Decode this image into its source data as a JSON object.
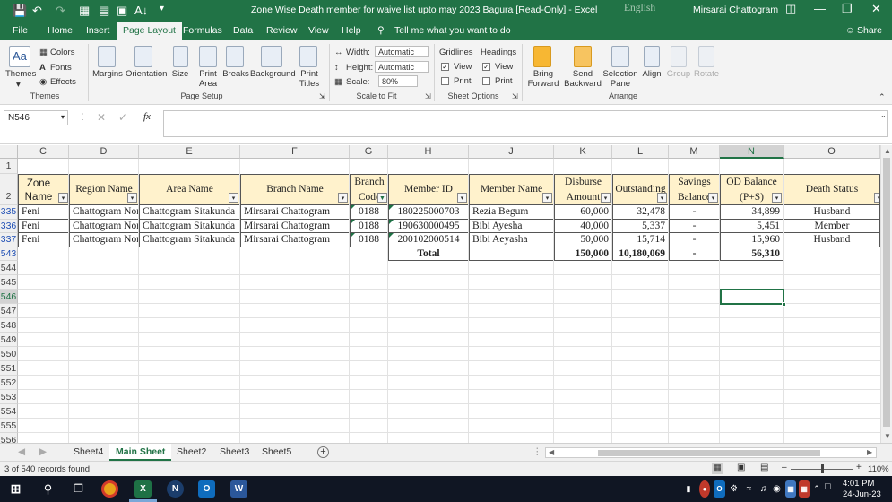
{
  "window": {
    "title": "Zone Wise Death member for waive list upto may 2023 Bagura  [Read-Only]  -  Excel",
    "language": "English",
    "user": "Mirsarai Chattogram"
  },
  "ribbon_tabs": [
    "File",
    "Home",
    "Insert",
    "Page Layout",
    "Formulas",
    "Data",
    "Review",
    "View",
    "Help"
  ],
  "active_tab": "Page Layout",
  "tell_me": "Tell me what you want to do",
  "share": "Share",
  "ribbon": {
    "themes": {
      "themes": "Themes",
      "colors": "Colors",
      "fonts": "Fonts",
      "effects": "Effects",
      "group": "Themes"
    },
    "page_setup": {
      "margins": "Margins",
      "orientation": "Orientation",
      "size": "Size",
      "print_area": "Print Area",
      "breaks": "Breaks",
      "background": "Background",
      "print_titles": "Print Titles",
      "group": "Page Setup"
    },
    "scale": {
      "width_label": "Width:",
      "width_value": "Automatic",
      "height_label": "Height:",
      "height_value": "Automatic",
      "scale_label": "Scale:",
      "scale_value": "80%",
      "group": "Scale to Fit"
    },
    "sheet_options": {
      "gridlines": "Gridlines",
      "headings": "Headings",
      "view": "View",
      "print": "Print",
      "group": "Sheet Options"
    },
    "arrange": {
      "bring_forward": "Bring Forward",
      "send_backward": "Send Backward",
      "selection_pane": "Selection Pane",
      "align": "Align",
      "group_btn": "Group",
      "rotate": "Rotate",
      "group": "Arrange"
    }
  },
  "formula_bar": {
    "name_box": "N546",
    "fx": "fx",
    "content": ""
  },
  "columns": [
    "C",
    "D",
    "E",
    "F",
    "G",
    "H",
    "J",
    "K",
    "L",
    "M",
    "N",
    "O"
  ],
  "header_row": {
    "zone": "Zone Name",
    "region": "Region Name",
    "area": "Area Name",
    "branch": "Branch Name",
    "branch_code": "Branch Code",
    "member_id": "Member ID",
    "member_name": "Member Name",
    "disburse": "Disburse Amount",
    "outstanding": "Outstanding",
    "savings": "Savings Balance",
    "od": "OD Balance (P+S)",
    "death": "Death Status"
  },
  "rows": [
    {
      "row": "335",
      "zone": "Feni",
      "region": "Chattogram North",
      "area": "Chattogram Sitakunda",
      "branch": "Mirsarai Chattogram",
      "code": "0188",
      "member_id": "180225000703",
      "name": "Rezia Begum",
      "disburse": "60,000",
      "outstanding": "32,478",
      "savings": "-",
      "od": "34,899",
      "death": "Husband"
    },
    {
      "row": "336",
      "zone": "Feni",
      "region": "Chattogram North",
      "area": "Chattogram Sitakunda",
      "branch": "Mirsarai Chattogram",
      "code": "0188",
      "member_id": "190630000495",
      "name": "Bibi Ayesha",
      "disburse": "40,000",
      "outstanding": "5,337",
      "savings": "-",
      "od": "5,451",
      "death": "Member"
    },
    {
      "row": "337",
      "zone": "Feni",
      "region": "Chattogram North",
      "area": "Chattogram Sitakunda",
      "branch": "Mirsarai Chattogram",
      "code": "0188",
      "member_id": "200102000514",
      "name": "Bibi Aeyasha",
      "disburse": "50,000",
      "outstanding": "15,714",
      "savings": "-",
      "od": "15,960",
      "death": "Husband"
    }
  ],
  "total_row": {
    "row": "543",
    "label": "Total",
    "disburse": "150,000",
    "outstanding": "10,180,069",
    "savings": "-",
    "od": "56,310"
  },
  "empty_rows": [
    "544",
    "545",
    "546",
    "547",
    "548",
    "549",
    "550",
    "551",
    "552",
    "553",
    "554",
    "555",
    "556"
  ],
  "first_rows": [
    "1",
    "2"
  ],
  "sheets": [
    "Sheet4",
    "Main Sheet",
    "Sheet2",
    "Sheet3",
    "Sheet5"
  ],
  "active_sheet": "Main Sheet",
  "status": {
    "records": "3 of 540 records found",
    "zoom": "110%"
  },
  "taskbar": {
    "time": "4:01 PM",
    "date": "24-Jun-23"
  },
  "colors": {
    "excel_green": "#217346",
    "header_fill": "#fff2cc",
    "row_number_blue": "#1f4fb5"
  }
}
